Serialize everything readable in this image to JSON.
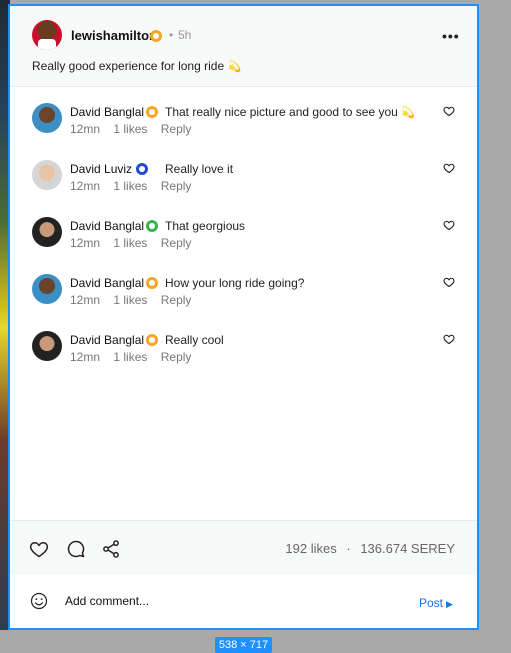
{
  "post": {
    "author": "lewishamilton",
    "separator": "•",
    "time": "5h",
    "more": "•••",
    "caption": "Really good experience for long ride",
    "caption_emoji": "💫"
  },
  "comments": [
    {
      "name": "David Banglal",
      "badge": "gold",
      "text": "That really nice picture and good to see you",
      "emoji": "💫",
      "time": "12mn",
      "likes": "1 likes",
      "reply": "Reply"
    },
    {
      "name": "David Luviz",
      "badge": "blue",
      "text": "Really love it",
      "emoji": "",
      "time": "12mn",
      "likes": "1 likes",
      "reply": "Reply"
    },
    {
      "name": "David Banglal",
      "badge": "green",
      "text": "That georgious",
      "emoji": "",
      "time": "12mn",
      "likes": "1 likes",
      "reply": "Reply"
    },
    {
      "name": "David Banglal",
      "badge": "gold",
      "text": "How your long ride going?",
      "emoji": "",
      "time": "12mn",
      "likes": "1 likes",
      "reply": "Reply"
    },
    {
      "name": "David Banglal",
      "badge": "gold",
      "text": "Really cool",
      "emoji": "",
      "time": "12mn",
      "likes": "1 likes",
      "reply": "Reply"
    }
  ],
  "actions": {
    "likes": "192 likes",
    "separator": "·",
    "serey": "136.674 SEREY"
  },
  "composer": {
    "placeholder": "Add comment...",
    "post_label": "Post",
    "post_arrow": "▶"
  },
  "dimension_label": "538 × 717",
  "colors": {
    "accent": "#1e90ff",
    "link": "#1a73e8",
    "badge_gold": "#f5a623",
    "badge_blue": "#2448d8",
    "badge_green": "#3bb54a"
  },
  "icons": [
    "verified-badge-icon",
    "more-icon",
    "heart-icon",
    "comment-icon",
    "share-icon",
    "smile-icon",
    "post-arrow-icon"
  ]
}
